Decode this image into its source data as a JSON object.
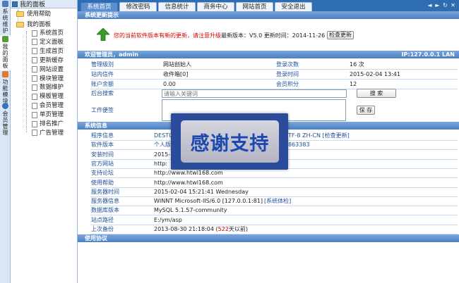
{
  "sidebar": {
    "tabs": [
      {
        "label": "系统维护",
        "color": "#4a7dc0"
      },
      {
        "label": "我的面板",
        "color": "#5a9a3c"
      },
      {
        "label": "功能模块",
        "color": "#e07b2c"
      },
      {
        "label": "会员管理",
        "color": "#3b6fc0"
      }
    ]
  },
  "tree": {
    "header": "我的面板",
    "help": "使用帮助",
    "mine": "我的面板",
    "items": [
      "系统首页",
      "定义面板",
      "生成首页",
      "更新缓存",
      "网站设置",
      "模块管理",
      "数据维护",
      "模板管理",
      "会员管理",
      "单页管理",
      "排名推广",
      "广告管理"
    ]
  },
  "topbar": {
    "tabs": [
      "系统首页",
      "修改密码",
      "信息统计",
      "商务中心",
      "网站首页",
      "安全退出"
    ],
    "active_tab": "系统首页",
    "window_buttons": [
      "◄",
      "►",
      "↻",
      "✕"
    ]
  },
  "update": {
    "bar_title": "系统更新提示",
    "message": "您的当前软件版本有新的更新，请注意升级",
    "latest_version": "最新版本：V5.0 更新时间：2014-11-26",
    "check_button": "检查更新",
    "icon": "up-arrow-icon",
    "icon_color": "#3c9a26"
  },
  "welcome": {
    "bar_title": "欢迎管理员，admin",
    "ip": "IP:127.0.0.1 LAN",
    "rows": [
      {
        "label": "管理级别",
        "value": "网站创始人",
        "label2": "登录次数",
        "value2": "16 次"
      },
      {
        "label": "站内信件",
        "value": "收件箱[0]",
        "label2": "登录时间",
        "value2": "2015-02-04 13:41"
      },
      {
        "label": "账户余额",
        "value": "0.00",
        "label2": "会员积分",
        "value2": "12"
      }
    ],
    "search_label": "后台搜索",
    "search_placeholder": "请输入关键词",
    "search_button": "搜 索",
    "memo_label": "工作便签",
    "save_button": "保 存"
  },
  "sysinfo": {
    "bar_title": "系统信息",
    "rows": [
      {
        "label": "程序信息",
        "value": "DESTO",
        "extra": "TF-8 ZH-CN [检查更新]"
      },
      {
        "label": "软件版本",
        "value": "个人版",
        "extra": "863383"
      },
      {
        "label": "安装时间",
        "value": "2015-"
      },
      {
        "label": "官方网站",
        "value": "http:"
      },
      {
        "label": "支持论坛",
        "value": "http://www.htwl168.com"
      },
      {
        "label": "使用帮助",
        "value": "http://www.htwl168.com"
      },
      {
        "label": "服务器时间",
        "value": "2015-02-04 15:21:41 Wednesday"
      },
      {
        "label": "服务器信息",
        "value": "WINNT Microsoft-IIS/6.0 [127.0.0.1:81]",
        "link": "[系统体检]"
      },
      {
        "label": "数据库版本",
        "value": "MySQL 5.1.57-community"
      },
      {
        "label": "站点路径",
        "value": "E:/ym/asp"
      },
      {
        "label": "上次备份",
        "value": "2013-08-30 21:18:04 (",
        "days": "522",
        "suffix": "天以前)"
      }
    ]
  },
  "help": {
    "bar_title": "使用协议"
  },
  "overlay": {
    "text": "感谢支持"
  },
  "colors": {
    "topbar": "#2f6db3",
    "label": "#1d4f95",
    "alert": "#d40000",
    "link": "#1d4f95"
  }
}
